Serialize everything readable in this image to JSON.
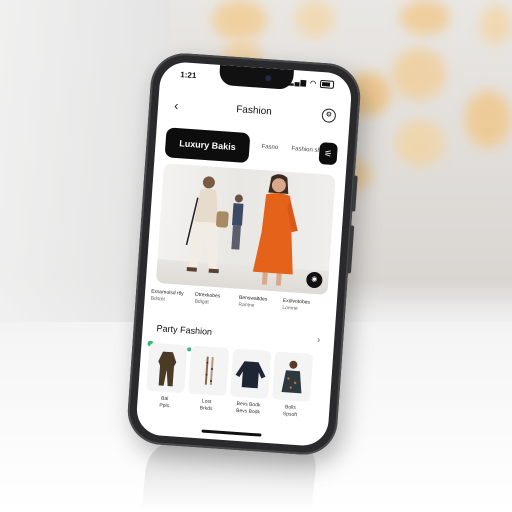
{
  "status": {
    "time": "1:21"
  },
  "header": {
    "back_icon": "back-arrow-icon",
    "title": "Fashion",
    "action_icon": "settings-icon"
  },
  "chips": {
    "active": "Luxury Bakis",
    "items": [
      "Fasno",
      "Fashion sh"
    ],
    "filter_icon": "sliders-icon"
  },
  "hero": {
    "action_icon": "camera-icon"
  },
  "captions": [
    {
      "title": "Exsomulsd rtly",
      "sub": "Bdstet"
    },
    {
      "title": "Dtrexkobes",
      "sub": "Bdlgdt"
    },
    {
      "title": "Benswaltdes",
      "sub": "Rantne"
    },
    {
      "title": "Exdivotobes",
      "sub": "Lomne"
    }
  ],
  "section": {
    "title": "Party Fashion",
    "more_icon": "chevron-right-icon"
  },
  "products": [
    {
      "label_1": "Bal",
      "label_2": "Ppls"
    },
    {
      "label_1": "Lost",
      "label_2": "Brkds"
    },
    {
      "label_1": "Bevs Bodk",
      "label_2": "Bevs Bodk"
    },
    {
      "label_1": "Bolls",
      "label_2": "Spsoft"
    }
  ],
  "colors": {
    "accent": "#0d0d0d",
    "dress": "#e4621a",
    "badge": "#3bb37a"
  }
}
